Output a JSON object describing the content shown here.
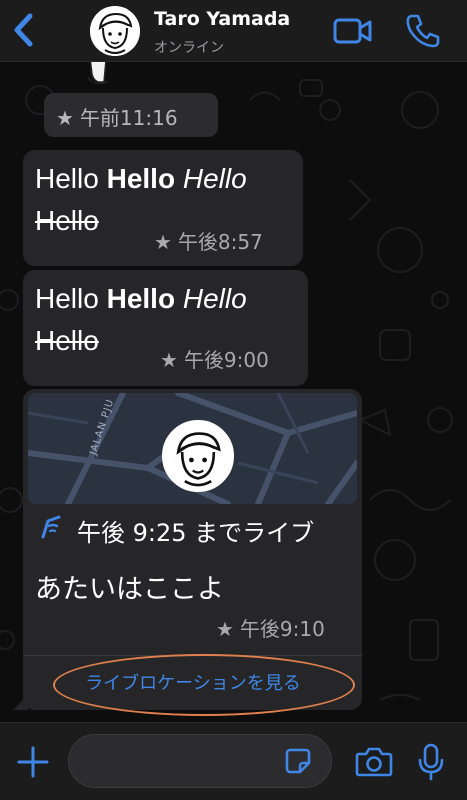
{
  "header": {
    "contact_name": "Taro Yamada",
    "status": "オンライン",
    "icons": [
      "chevron-left-icon",
      "video-call-icon",
      "phone-icon"
    ]
  },
  "messages": [
    {
      "type": "time_chip",
      "star": "★",
      "time": "午前11:16"
    },
    {
      "type": "text",
      "segments": {
        "plain": "Hello",
        "bold": "Hello",
        "italic": "Hello",
        "strikethrough": "Hello"
      },
      "star": "★",
      "time": "午後8:57"
    },
    {
      "type": "text",
      "segments": {
        "plain": "Hello",
        "bold": "Hello",
        "italic": "Hello",
        "strikethrough": "Hello"
      },
      "star": "★",
      "time": "午後9:00"
    },
    {
      "type": "live_location",
      "map_street": "JALAN PJU",
      "live_until": "午後 9:25 までライブ",
      "caption": "あたいはここよ",
      "star": "★",
      "time": "午後9:10",
      "action_label": "ライブロケーションを見る"
    }
  ],
  "input_bar": {
    "placeholder": "",
    "icons": [
      "plus-icon",
      "sticker-icon",
      "camera-icon",
      "microphone-icon"
    ]
  },
  "colors": {
    "accent": "#3f86e6",
    "header_bg": "#1c1c1d",
    "bubble_bg": "#262628",
    "highlight_ring": "#e0804e"
  }
}
